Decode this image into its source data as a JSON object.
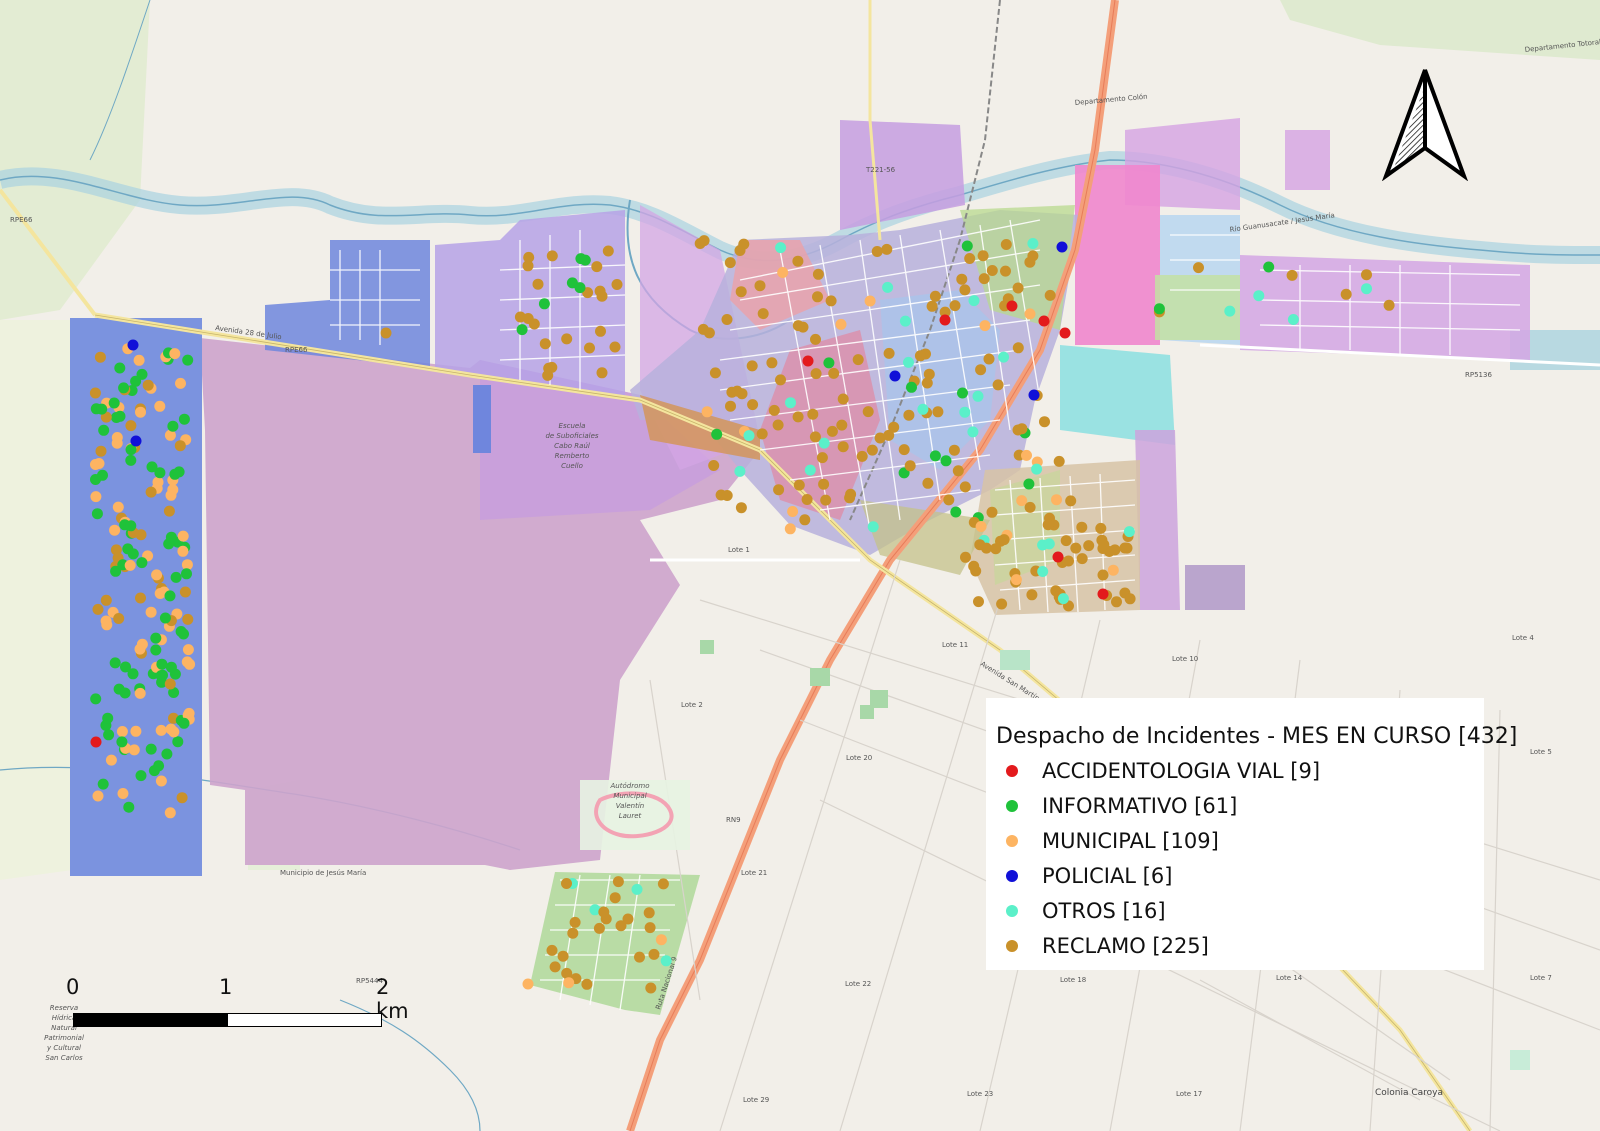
{
  "legend": {
    "title": "Despacho de Incidentes - MES EN CURSO [432]",
    "items": [
      {
        "label": "ACCIDENTOLOGIA VIAL [9]",
        "color": "#e31a1c"
      },
      {
        "label": "INFORMATIVO [61]",
        "color": "#1fc23a"
      },
      {
        "label": "MUNICIPAL [109]",
        "color": "#fdb462"
      },
      {
        "label": "POLICIAL [6]",
        "color": "#1010d8"
      },
      {
        "label": "OTROS [16]",
        "color": "#5bf0c9"
      },
      {
        "label": "RECLAMO [225]",
        "color": "#c9912a"
      }
    ]
  },
  "scale_bar": {
    "ticks": [
      "0",
      "1",
      "2 km"
    ]
  },
  "north_arrow": {
    "icon": "north-arrow-icon"
  },
  "map_labels": {
    "escuela": [
      "Escuela",
      "de Suboficiales",
      "Cabo Raúl",
      "Remberto",
      "Cuello"
    ],
    "autodromo": [
      "Autódromo",
      "Municipal",
      "Valentín",
      "Lauret"
    ],
    "reserva": [
      "Reserva",
      "Hídrica",
      "Natural",
      "Patrimonial",
      "y Cultural",
      "San Carlos"
    ],
    "colonia_caroya": "Colonia Caroya",
    "rio_guanusacate": "Río Guanusacate / Jesús María",
    "municipio_jesus_maria": "Municipio de Jesús María",
    "departamento_colon": "Departamento Colón",
    "departamento_totoral": "Departamento Totoral",
    "ruta_nacional_9": "Ruta Nacional 9",
    "avenida_san_martin": "Avenida San Martín",
    "avenida_28_julio": "Avenida 28 de Julio",
    "lote_labels": [
      "Lote 1",
      "Lote 2",
      "Lote 4",
      "Lote 5",
      "Lote 7",
      "Lote 10",
      "Lote 11",
      "Lote 14",
      "Lote 17",
      "Lote 18",
      "Lote 20",
      "Lote 21",
      "Lote 22",
      "Lote 23",
      "Lote 29"
    ],
    "road_codes": [
      "RPE66",
      "RPE66",
      "RP5136",
      "RP5444",
      "RN9",
      "T221-56"
    ]
  }
}
